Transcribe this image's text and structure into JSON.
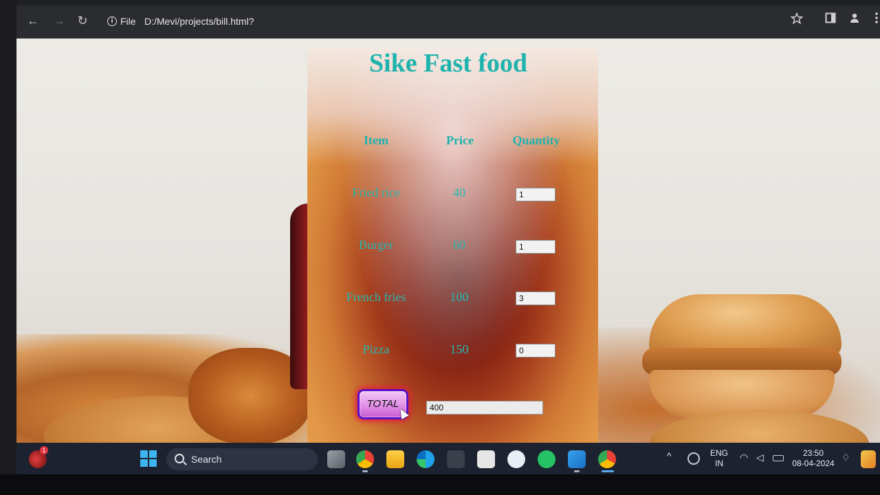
{
  "browser": {
    "back_glyph": "←",
    "forward_glyph": "→",
    "reload_glyph": "↻",
    "site_info_label": "File",
    "url": "D:/Mevi/projects/bill.html?"
  },
  "page": {
    "title": "Sike Fast food",
    "table": {
      "headers": [
        "Item",
        "Price",
        "Quantity"
      ],
      "rows": [
        {
          "item": "Fried rice",
          "price": "40",
          "quantity": "1"
        },
        {
          "item": "Burger",
          "price": "60",
          "quantity": "1"
        },
        {
          "item": "French fries",
          "price": "100",
          "quantity": "3"
        },
        {
          "item": "Pizza",
          "price": "150",
          "quantity": "0"
        }
      ]
    },
    "total_button": "TOTAL",
    "total_value": "400"
  },
  "taskbar": {
    "search_label": "Search",
    "notification_count": "1",
    "language_line1": "ENG",
    "language_line2": "IN",
    "time": "23:50",
    "date": "08-04-2024"
  },
  "colors": {
    "accent_teal": "#1fb3ad",
    "button_border": "#5a10c8",
    "button_glow": "#e0203a"
  }
}
